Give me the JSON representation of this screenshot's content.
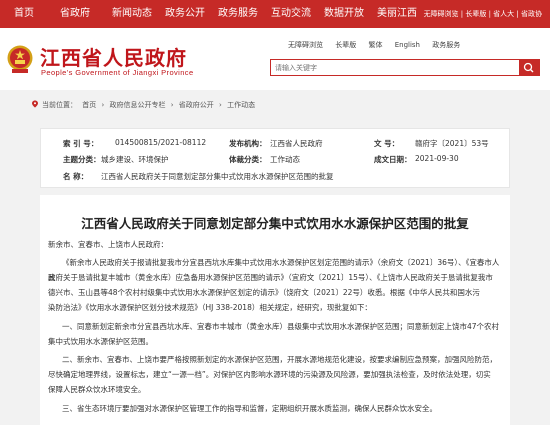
{
  "nav": {
    "items": [
      "首页",
      "省政府",
      "新闻动态",
      "政务公开",
      "政务服务",
      "互动交流",
      "数据开放",
      "美丽江西"
    ],
    "util": "无障碍浏览 | 长辈版 | 省人大 | 省政协"
  },
  "logo": {
    "cn": "江西省人民政府",
    "en": "People's Government of Jiangxi Province"
  },
  "lang_links": [
    "无障碍浏览",
    "长辈版",
    "繁体",
    "English",
    "政务服务"
  ],
  "search": {
    "placeholder": "请输入关键字"
  },
  "breadcrumb": [
    "当前位置：",
    "首页",
    "›",
    "政府信息公开专栏",
    "›",
    "省政府公开",
    "›",
    "工作动态"
  ],
  "meta": {
    "index_label": "索    引 号：",
    "index_value": "014500815/2021-08112",
    "publisher_label": "发布机构：",
    "publisher_value": "江西省人民政府",
    "docno_label": "文    号：",
    "docno_value": "赣府字〔2021〕53号",
    "topic_label": "主题分类：",
    "topic_value": "城乡建设、环境保护",
    "type_label": "体裁分类：",
    "type_value": "工作动态",
    "date_label": "成文日期：",
    "date_value": "2021-09-30",
    "name_label": "名    称：",
    "name_value": "江西省人民政府关于同意划定部分集中式饮用水水源保护区范围的批复"
  },
  "article": {
    "title": "江西省人民政府关于同意划定部分集中式饮用水水源保护区范围的批复",
    "recipient": "新余市、宜春市、上饶市人民政府：",
    "p1_l1": "《新余市人民政府关于报请批复我市分宜县西坑水库集中式饮用水水源保护区划定范围的请示》（余府文〔2021〕36号）、《宜春市人民",
    "p1_l2": "政府关于恳请批复丰城市（黄金水库）应急备用水源保护区范围的请示》（宜府文〔2021〕15号）、《上饶市人民政府关于恳请批复我市",
    "p1_l3": "德兴市、玉山县等48个农村村级集中式饮用水水源保护区划定的请示》（饶府文〔2021〕22号）收悉。根据《中华人民共和国水污",
    "p1_l4": "染防治法》《饮用水水源保护区划分技术规范》（HJ 338-2018）相关规定，经研究，现批复如下：",
    "p2_l1": "一、同意新划定新余市分宜县西坑水库、宜春市丰城市（黄金水库）县级集中式饮用水水源保护区范围；同意新划定上饶市47个农村",
    "p2_l2": "集中式饮用水水源保护区范围。",
    "p3_l1": "二、新余市、宜春市、上饶市要严格按照新划定的水源保护区范围，开展水源地规范化建设，按要求编制应急预案，加强风险防范，",
    "p3_l2": "尽快确定地理界线，设置标志，建立“一源一档”。对保护区内影响水源环境的污染源及风险源，要加强执法检查，及时依法处理，切实",
    "p3_l3": "保障人民群众饮水环境安全。",
    "p4_l1": "三、省生态环境厅要加强对水源保护区管理工作的指导和监督，定期组织开展水质监测，确保人民群众饮水安全。"
  },
  "colors": {
    "brand_red": "#c62a27",
    "logo_red": "#c0161b"
  }
}
